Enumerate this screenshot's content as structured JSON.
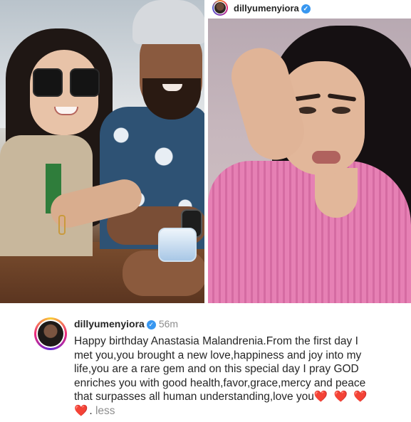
{
  "post": {
    "username": "dillyumenyiora",
    "verified_mark": "✓",
    "timestamp": "56m",
    "caption_text": "Happy birthday Anastasia Malandrenia.From the first day I met you,you brought a new love,happiness and joy into my life,you are a rare gem and on this special day I pray GOD enriches you with good health,favor,grace,mercy and peace that surpasses all human understanding,love you",
    "caption_hearts": "❤️ ❤️ ❤️ ❤️",
    "caption_suffix": ". ",
    "more_toggle": "less"
  },
  "icons": {
    "verified": "verified-badge-icon",
    "avatar": "profile-avatar"
  },
  "colors": {
    "verified_blue": "#3897f0",
    "muted_text": "#8e8e8e",
    "heart_red": "#e0202b"
  }
}
